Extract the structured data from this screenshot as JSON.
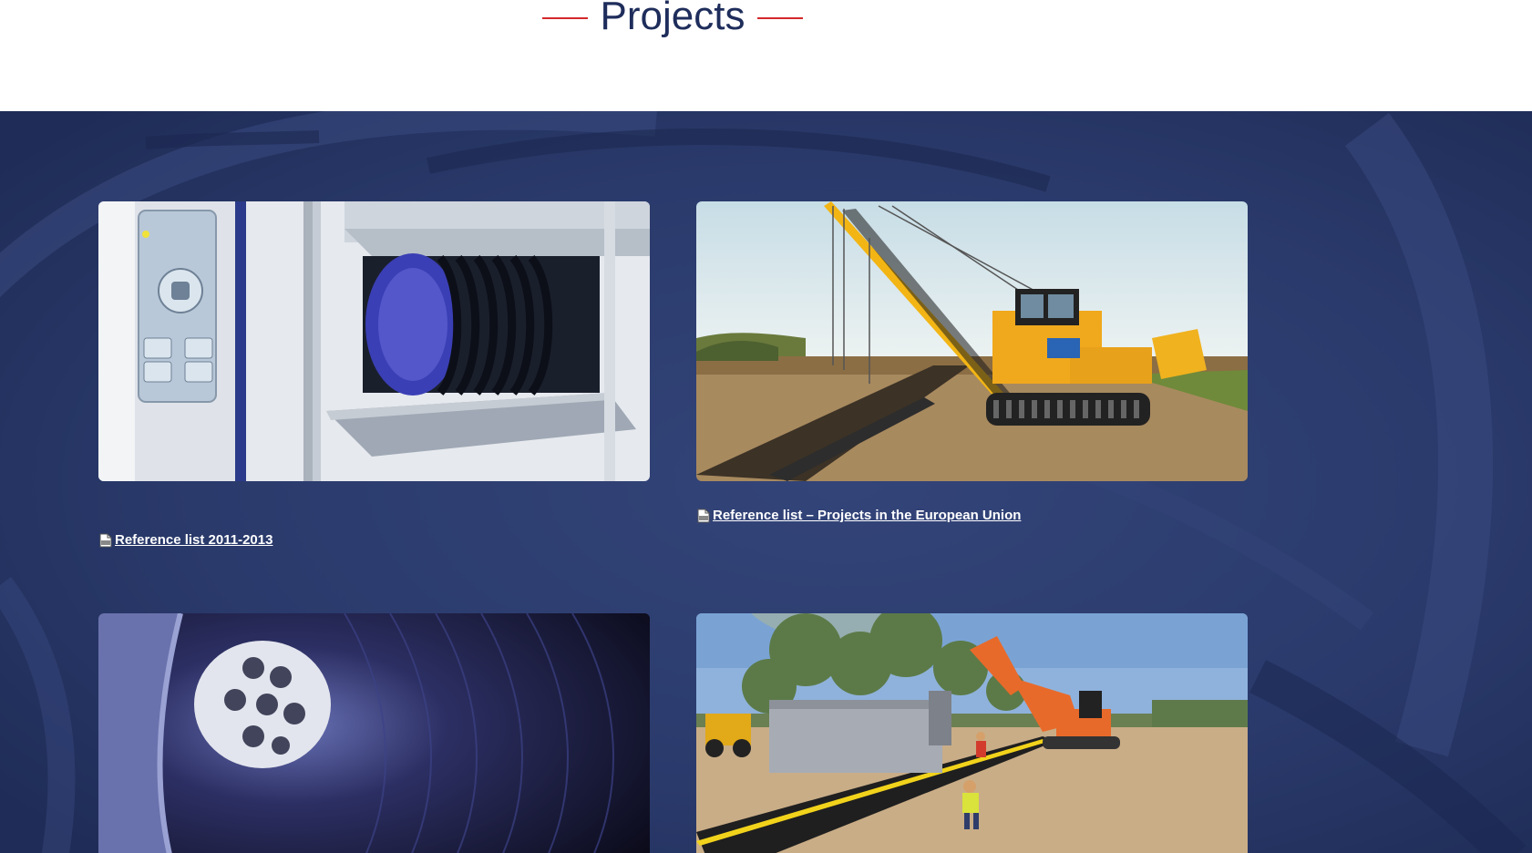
{
  "header": {
    "title": "Projects"
  },
  "projects": [
    {
      "image": "pipe-testing-machine-photo",
      "link_label": "Reference list 2011-2013",
      "link_icon": "pdf-icon"
    },
    {
      "image": "pipelayer-crane-photo",
      "link_label": "Reference list – Projects in the European Union",
      "link_icon": "pdf-icon"
    },
    {
      "image": "pipe-interior-photo",
      "link_label": "",
      "link_icon": ""
    },
    {
      "image": "pipeline-construction-excavator-photo",
      "link_label": "",
      "link_icon": ""
    }
  ],
  "colors": {
    "title": "#1e2d5b",
    "title_lines": "#d3292b",
    "section_bg": "#2a3a6b",
    "link_text": "#ffffff"
  }
}
